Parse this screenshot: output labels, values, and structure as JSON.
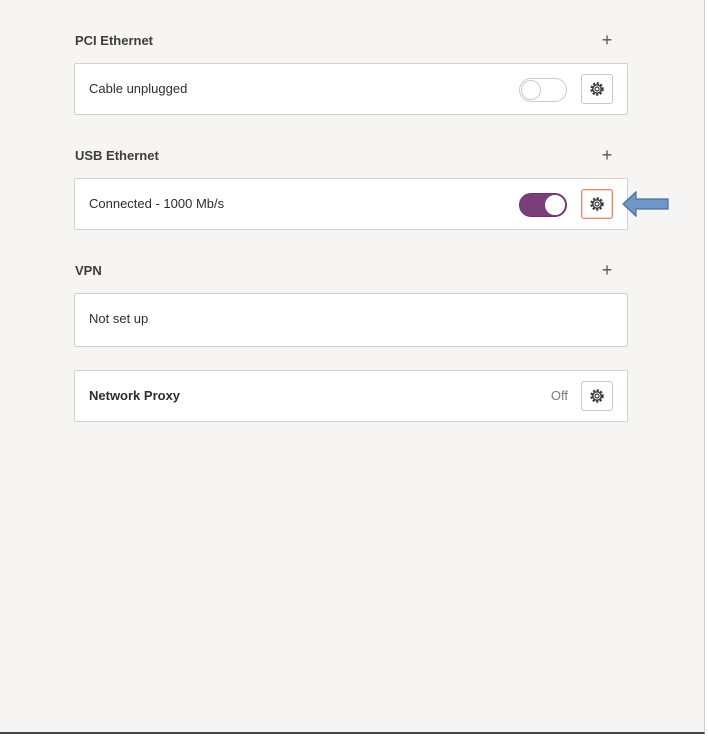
{
  "sections": {
    "pci": {
      "title": "PCI Ethernet",
      "add_label": "+",
      "status": "Cable unplugged",
      "toggle_state": "off"
    },
    "usb": {
      "title": "USB Ethernet",
      "add_label": "+",
      "status": "Connected - 1000 Mb/s",
      "toggle_state": "on"
    },
    "vpn": {
      "title": "VPN",
      "add_label": "+",
      "status": "Not set up"
    },
    "proxy": {
      "label": "Network Proxy",
      "status": "Off"
    }
  },
  "icons": {
    "settings": "gear-icon",
    "add": "plus-icon",
    "annotation": "arrow-left-icon"
  },
  "colors": {
    "toggle_on": "#7a3f7a",
    "focus_border": "#e08a6c",
    "arrow_fill": "#6f95c9",
    "arrow_stroke": "#4a6f9f"
  }
}
